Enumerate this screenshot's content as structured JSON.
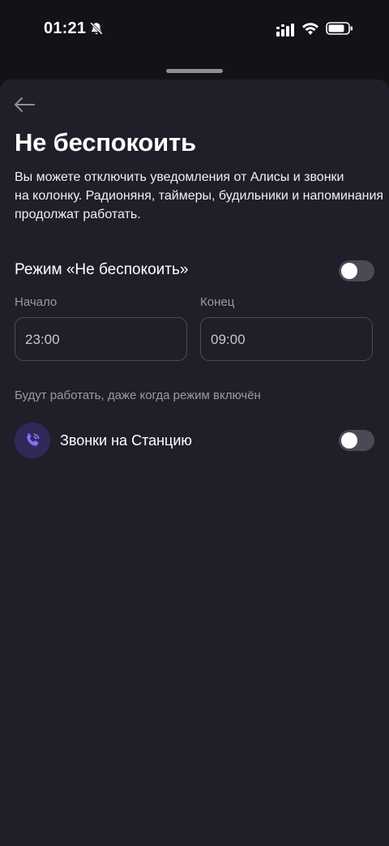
{
  "status_bar": {
    "time": "01:21",
    "icons": [
      "bell-off-icon",
      "signal-icon",
      "wifi-icon",
      "battery-icon"
    ]
  },
  "header": {
    "back_icon": "arrow-left-icon",
    "title": "Не беспокоить"
  },
  "description": {
    "lines": [
      "Вы можете отключить уведомления от Алисы и звонки",
      "на колонку. Радионяня, таймеры, будильники и напоминания",
      "продолжат работать."
    ]
  },
  "dnd_mode": {
    "label": "Режим «Не беспокоить»",
    "enabled": false
  },
  "schedule": {
    "start_label": "Начало",
    "start_value": "23:00",
    "end_label": "Конец",
    "end_value": "09:00"
  },
  "exceptions": {
    "hint": "Будут работать, даже когда режим включён",
    "items": [
      {
        "icon": "phone-call-icon",
        "label": "Звонки на Станцию",
        "enabled": false
      }
    ]
  },
  "colors": {
    "sheet_background": "#1f1f2a",
    "screen_background": "#131317",
    "accent_purple": "#8d6cff",
    "toggle_off": "#4a4a55"
  }
}
